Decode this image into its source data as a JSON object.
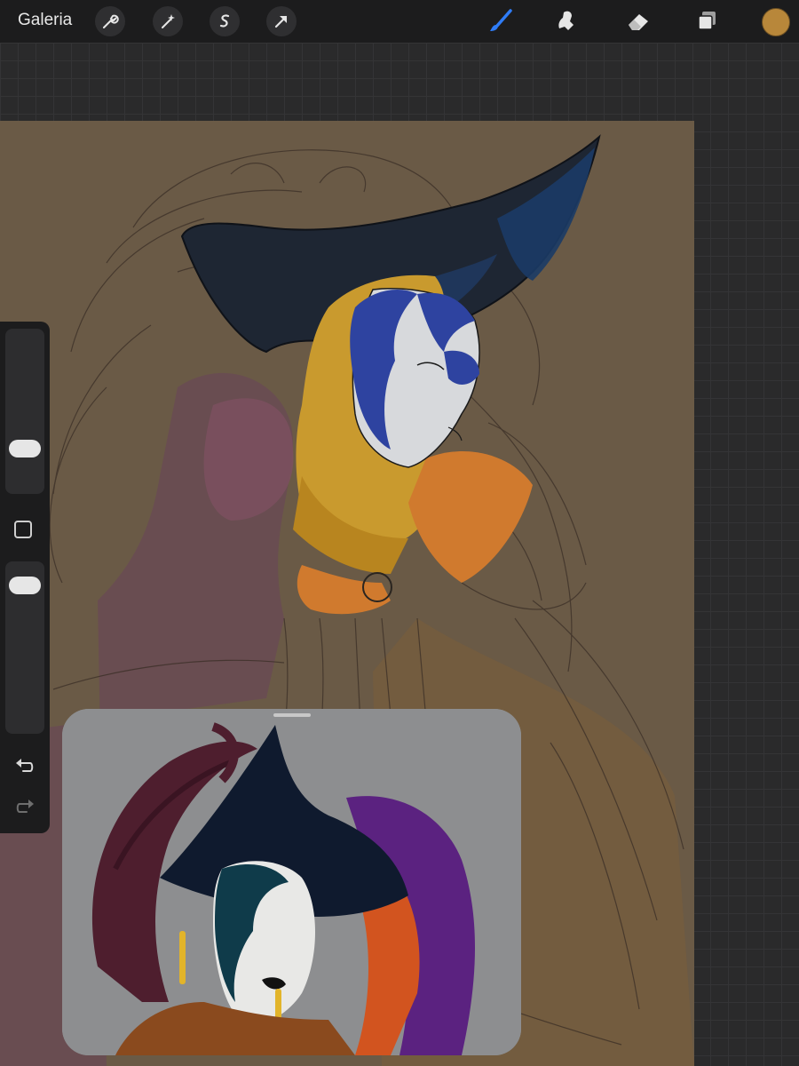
{
  "toolbar": {
    "gallery_label": "Galeria",
    "left_tools": [
      "wrench-icon",
      "magic-wand-icon",
      "selection-icon",
      "transform-arrow-icon"
    ],
    "right_tools": [
      "brush-icon",
      "smudge-icon",
      "eraser-icon",
      "layers-icon"
    ],
    "active_tool": "brush",
    "accent_color": "#2f7cf6",
    "current_color": "#b8873a"
  },
  "side_panel": {
    "brush_size_level": 0.75,
    "opacity_level": 0.9,
    "modify_icon": "square-button-icon",
    "undo_icon": "undo-icon",
    "redo_icon": "redo-icon"
  },
  "canvas": {
    "background_color": "#6a5a46"
  },
  "reference_window": {
    "background_color": "#8d8e90"
  }
}
